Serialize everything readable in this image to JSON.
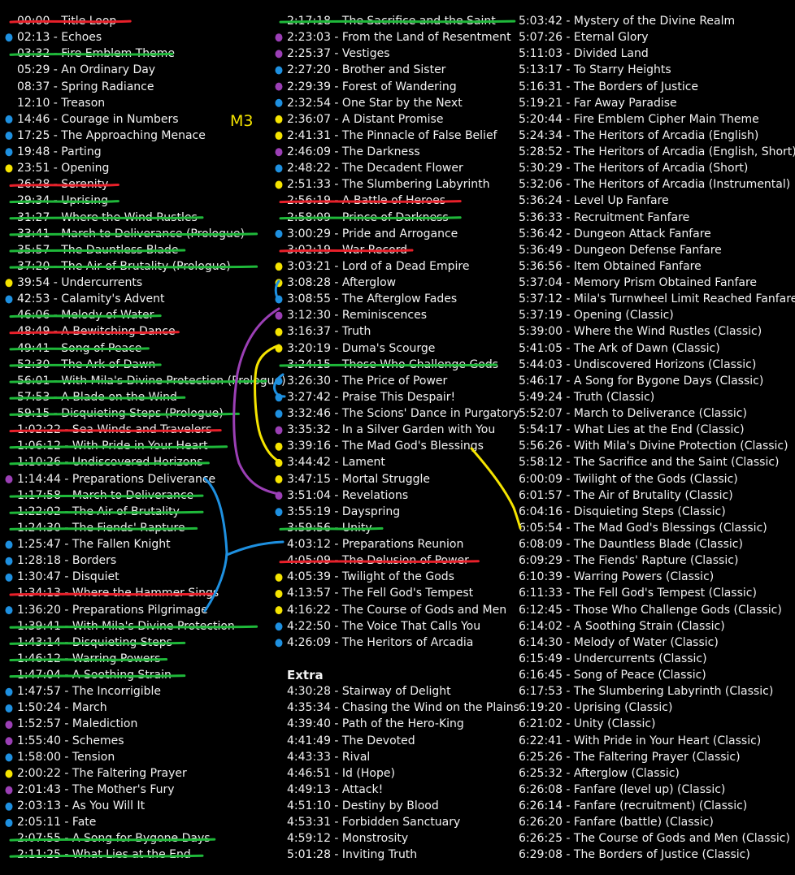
{
  "columns": [
    [
      {
        "text": "00:00 - Title Loop",
        "strike": "red"
      },
      {
        "text": "02:13 - Echoes",
        "dot": "blue"
      },
      {
        "text": "03:32 - Fire Emblem Theme",
        "strike": "green"
      },
      {
        "text": "05:29 - An Ordinary Day"
      },
      {
        "text": "08:37 - Spring Radiance"
      },
      {
        "text": "12:10 - Treason"
      },
      {
        "text": "14:46 - Courage in Numbers",
        "dot": "blue"
      },
      {
        "text": "17:25 - The Approaching Menace",
        "dot": "blue"
      },
      {
        "text": "19:48 - Parting",
        "dot": "blue"
      },
      {
        "text": "23:51 - Opening",
        "dot": "yellow"
      },
      {
        "text": "26:28 - Serenity",
        "strike": "red"
      },
      {
        "text": "29:34 - Uprising",
        "strike": "green"
      },
      {
        "text": "31:27 - Where the Wind Rustles",
        "strike": "green"
      },
      {
        "text": "33:41 - March to Deliverance (Prologue)",
        "strike": "green"
      },
      {
        "text": "35:57 - The Dauntless Blade",
        "strike": "green"
      },
      {
        "text": "37:20 - The Air of Brutality (Prologue)",
        "strike": "green"
      },
      {
        "text": "39:54 - Undercurrents",
        "dot": "yellow"
      },
      {
        "text": "42:53 - Calamity's Advent",
        "dot": "blue"
      },
      {
        "text": "46:06 - Melody of Water",
        "strike": "green"
      },
      {
        "text": "48:49 - A Bewitching Dance",
        "strike": "red"
      },
      {
        "text": "49:41 - Song of Peace",
        "strike": "green"
      },
      {
        "text": "52:30 - The Ark of Dawn",
        "strike": "green"
      },
      {
        "text": "56:01 - With Mila's Divine Protection (Prologue)",
        "strike": "green"
      },
      {
        "text": "57:53 - A Blade on the Wind",
        "strike": "green"
      },
      {
        "text": "59:15 - Disquieting Steps (Prologue)",
        "strike": "green"
      },
      {
        "text": "1:02:22 - Sea Winds and Travelers",
        "strike": "red"
      },
      {
        "text": "1:06:12 - With Pride in Your Heart",
        "strike": "green"
      },
      {
        "text": "1:10:26 - Undiscovered Horizons",
        "strike": "green"
      },
      {
        "text": "1:14:44 - Preparations Deliverance",
        "dot": "purple"
      },
      {
        "text": "1:17:58 - March to Deliverance",
        "strike": "green"
      },
      {
        "text": "1:22:02 - The Air of Brutality",
        "strike": "green"
      },
      {
        "text": "1:24:30 - The Fiends' Rapture",
        "strike": "green"
      },
      {
        "text": "1:25:47 - The Fallen Knight",
        "dot": "blue"
      },
      {
        "text": "1:28:18 - Borders",
        "dot": "blue"
      },
      {
        "text": "1:30:47 - Disquiet",
        "dot": "blue"
      },
      {
        "text": "1:34:13 - Where the Hammer Sings",
        "strike": "red"
      },
      {
        "text": "1:36:20 - Preparations Pilgrimage",
        "dot": "blue"
      },
      {
        "text": "1:39:41 - With Mila's Divine Protection",
        "strike": "green"
      },
      {
        "text": "1:43:14 - Disquieting Steps",
        "strike": "green"
      },
      {
        "text": "1:46:12 - Warring Powers",
        "strike": "green"
      },
      {
        "text": "1:47:04 - A Soothing Strain",
        "strike": "green"
      },
      {
        "text": "1:47:57 - The Incorrigible",
        "dot": "blue"
      },
      {
        "text": "1:50:24 - March",
        "dot": "blue"
      },
      {
        "text": "1:52:57 - Malediction",
        "dot": "purple"
      },
      {
        "text": "1:55:40 - Schemes",
        "dot": "purple"
      },
      {
        "text": "1:58:00 - Tension",
        "dot": "blue"
      },
      {
        "text": "2:00:22 - The Faltering Prayer",
        "dot": "yellow"
      },
      {
        "text": "2:01:43 - The Mother's Fury",
        "dot": "purple"
      },
      {
        "text": "2:03:13 - As You Will It",
        "dot": "blue"
      },
      {
        "text": "2:05:11 - Fate",
        "dot": "blue"
      },
      {
        "text": "2:07:55 - A Song for Bygone Days",
        "strike": "green"
      },
      {
        "text": "2:11:25 - What Lies at the End",
        "strike": "green"
      }
    ],
    [
      {
        "text": "2:17:18 - The Sacrifice and the Saint",
        "strike": "green"
      },
      {
        "text": "2:23:03 - From the Land of Resentment",
        "dot": "purple"
      },
      {
        "text": "2:25:37 - Vestiges",
        "dot": "purple"
      },
      {
        "text": "2:27:20 - Brother and Sister",
        "dot": "blue"
      },
      {
        "text": "2:29:39 - Forest of Wandering",
        "dot": "purple"
      },
      {
        "text": "2:32:54 - One Star by the Next",
        "dot": "blue"
      },
      {
        "text": "2:36:07 - A Distant Promise",
        "dot": "yellow"
      },
      {
        "text": "2:41:31 - The Pinnacle of False Belief",
        "dot": "yellow"
      },
      {
        "text": "2:46:09 - The Darkness",
        "dot": "purple"
      },
      {
        "text": "2:48:22 - The Decadent Flower",
        "dot": "blue"
      },
      {
        "text": "2:51:33 - The Slumbering Labyrinth",
        "dot": "yellow"
      },
      {
        "text": "2:56:19 - A Battle of Heroes",
        "strike": "red"
      },
      {
        "text": "2:58:09 - Prince of Darkness",
        "strike": "green"
      },
      {
        "text": "3:00:29 - Pride and Arrogance",
        "dot": "blue"
      },
      {
        "text": "3:02:19 - War Record",
        "strike": "red"
      },
      {
        "text": "3:03:21 - Lord of a Dead Empire",
        "dot": "yellow"
      },
      {
        "text": "3:08:28 - Afterglow",
        "dot": "yellow"
      },
      {
        "text": "3:08:55 - The Afterglow Fades",
        "dot": "blue"
      },
      {
        "text": "3:12:30 - Reminiscences",
        "dot": "purple"
      },
      {
        "text": "3:16:37 - Truth",
        "dot": "yellow"
      },
      {
        "text": "3:20:19 - Duma's Scourge",
        "dot": "yellow"
      },
      {
        "text": "3:24:15 - Those Who Challenge Gods",
        "strike": "green"
      },
      {
        "text": "3:26:30 - The Price of Power",
        "dot": "blue"
      },
      {
        "text": "3:27:42 - Praise This Despair!",
        "dot": "blue"
      },
      {
        "text": "3:32:46 - The Scions' Dance in Purgatory",
        "dot": "blue"
      },
      {
        "text": "3:35:32 - In a Silver Garden with You",
        "dot": "purple"
      },
      {
        "text": "3:39:16 - The Mad God's Blessings",
        "dot": "yellow"
      },
      {
        "text": "3:44:42 - Lament",
        "dot": "yellow"
      },
      {
        "text": "3:47:15 - Mortal Struggle",
        "dot": "yellow"
      },
      {
        "text": "3:51:04 - Revelations",
        "dot": "purple"
      },
      {
        "text": "3:55:19 - Dayspring",
        "dot": "blue"
      },
      {
        "text": "3:59:56 - Unity",
        "strike": "green"
      },
      {
        "text": "4:03:12 - Preparations Reunion"
      },
      {
        "text": "4:05:09 - The Delusion of Power",
        "strike": "red"
      },
      {
        "text": "4:05:39 - Twilight of the Gods",
        "dot": "yellow"
      },
      {
        "text": "4:13:57 - The Fell God's Tempest",
        "dot": "yellow"
      },
      {
        "text": "4:16:22 - The Course of Gods and Men",
        "dot": "yellow"
      },
      {
        "text": "4:22:50 - The Voice That Calls You",
        "dot": "blue"
      },
      {
        "text": "4:26:09 - The Heritors of Arcadia",
        "dot": "blue"
      },
      {
        "spacer": true
      },
      {
        "text": "Extra",
        "heading": true
      },
      {
        "text": "4:30:28 - Stairway of Delight"
      },
      {
        "text": "4:35:34 - Chasing the Wind on the Plains"
      },
      {
        "text": "4:39:40 - Path of the Hero-King"
      },
      {
        "text": "4:41:49 - The Devoted"
      },
      {
        "text": "4:43:33 - Rival"
      },
      {
        "text": "4:46:51 - Id (Hope)"
      },
      {
        "text": "4:49:13 - Attack!"
      },
      {
        "text": "4:51:10 - Destiny by Blood"
      },
      {
        "text": "4:53:31 - Forbidden Sanctuary"
      },
      {
        "text": "4:59:12 - Monstrosity"
      },
      {
        "text": "5:01:28 - Inviting Truth"
      }
    ],
    [
      {
        "text": "5:03:42 - Mystery of the Divine Realm"
      },
      {
        "text": "5:07:26 - Eternal Glory"
      },
      {
        "text": "5:11:03 - Divided Land"
      },
      {
        "text": "5:13:17 - To Starry Heights"
      },
      {
        "text": "5:16:31 - The Borders of Justice"
      },
      {
        "text": "5:19:21 - Far Away Paradise"
      },
      {
        "text": "5:20:44 - Fire Emblem Cipher Main Theme"
      },
      {
        "text": "5:24:34 - The Heritors of Arcadia (English)"
      },
      {
        "text": "5:28:52 - The Heritors of Arcadia (English, Short)"
      },
      {
        "text": "5:30:29 - The Heritors of Arcadia (Short)"
      },
      {
        "text": "5:32:06 - The Heritors of Arcadia (Instrumental)"
      },
      {
        "text": "5:36:24 - Level Up Fanfare"
      },
      {
        "text": "5:36:33 - Recruitment Fanfare"
      },
      {
        "text": "5:36:42 - Dungeon Attack Fanfare"
      },
      {
        "text": "5:36:49 - Dungeon Defense Fanfare"
      },
      {
        "text": "5:36:56 - Item Obtained Fanfare"
      },
      {
        "text": "5:37:04 - Memory Prism Obtained Fanfare"
      },
      {
        "text": "5:37:12 - Mila's Turnwheel Limit Reached Fanfare"
      },
      {
        "text": "5:37:19 - Opening (Classic)"
      },
      {
        "text": "5:39:00 - Where the Wind Rustles (Classic)"
      },
      {
        "text": "5:41:05 - The Ark of Dawn (Classic)"
      },
      {
        "text": "5:44:03 - Undiscovered Horizons (Classic)"
      },
      {
        "text": "5:46:17 - A Song for Bygone Days (Classic)"
      },
      {
        "text": "5:49:24 - Truth (Classic)"
      },
      {
        "text": "5:52:07 - March to Deliverance (Classic)"
      },
      {
        "text": "5:54:17 - What Lies at the End (Classic)"
      },
      {
        "text": "5:56:26 - With Mila's Divine Protection (Classic)"
      },
      {
        "text": "5:58:12 - The Sacrifice and the Saint (Classic)"
      },
      {
        "text": "6:00:09 - Twilight of the Gods (Classic)"
      },
      {
        "text": "6:01:57 - The Air of Brutality (Classic)"
      },
      {
        "text": "6:04:16 - Disquieting Steps (Classic)"
      },
      {
        "text": "6:05:54 - The Mad God's Blessings (Classic)"
      },
      {
        "text": "6:08:09 - The Dauntless Blade (Classic)"
      },
      {
        "text": "6:09:29 - The Fiends' Rapture (Classic)"
      },
      {
        "text": "6:10:39 - Warring Powers (Classic)"
      },
      {
        "text": "6:11:33 - The Fell God's Tempest (Classic)"
      },
      {
        "text": "6:12:45 - Those Who Challenge Gods (Classic)"
      },
      {
        "text": "6:14:02 - A Soothing Strain (Classic)"
      },
      {
        "text": "6:14:30 - Melody of Water (Classic)"
      },
      {
        "text": "6:15:49 - Undercurrents (Classic)"
      },
      {
        "text": "6:16:45 - Song of Peace (Classic)"
      },
      {
        "text": "6:17:53 - The Slumbering Labyrinth (Classic)"
      },
      {
        "text": "6:19:20 - Uprising (Classic)"
      },
      {
        "text": "6:21:02 - Unity (Classic)"
      },
      {
        "text": "6:22:41 - With Pride in Your Heart (Classic)"
      },
      {
        "text": "6:25:26 - The Faltering Prayer (Classic)"
      },
      {
        "text": "6:25:32 - Afterglow (Classic)"
      },
      {
        "text": "6:26:08 - Fanfare (level up) (Classic)"
      },
      {
        "text": "6:26:14 - Fanfare (recruitment) (Classic)"
      },
      {
        "text": "6:26:20 - Fanfare (battle) (Classic)"
      },
      {
        "text": "6:26:25 - The Course of Gods and Men (Classic)"
      },
      {
        "text": "6:29:08 - The Borders of Justice (Classic)"
      }
    ]
  ],
  "annotation_label": "M3",
  "colors": {
    "background": "#000000",
    "text": "#f2f2f2",
    "red": "#e8202a",
    "green": "#1fb83a",
    "blue": "#1e90e0",
    "purple": "#9b3fb5",
    "yellow": "#f5e400"
  }
}
